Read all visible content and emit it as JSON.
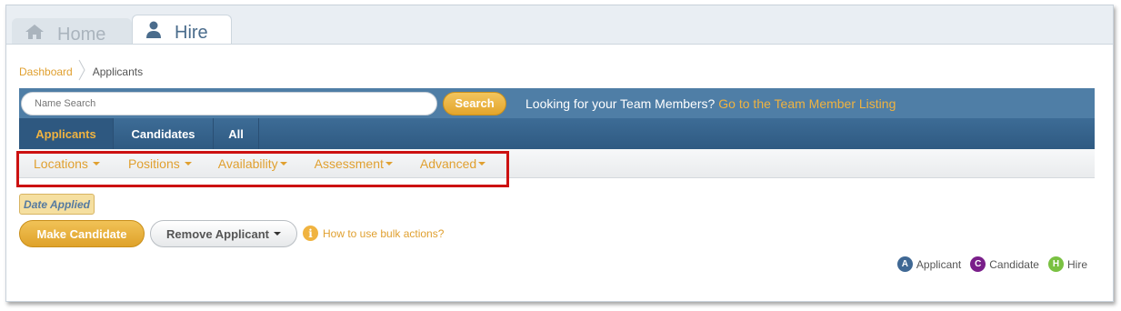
{
  "tabs": {
    "home_label": "Home",
    "hire_label": "Hire"
  },
  "breadcrumb": {
    "root": "Dashboard",
    "current": "Applicants"
  },
  "search": {
    "placeholder": "Name Search",
    "button_label": "Search",
    "team_text": "Looking for your Team Members?",
    "team_link": "Go to the Team Member Listing"
  },
  "subtabs": [
    {
      "label": "Applicants",
      "active": true
    },
    {
      "label": "Candidates",
      "active": false
    },
    {
      "label": "All",
      "active": false
    }
  ],
  "filters": [
    "Locations",
    "Positions",
    "Availability",
    "Assessment",
    "Advanced"
  ],
  "sort_badge": "Date Applied",
  "actions": {
    "make_candidate": "Make Candidate",
    "remove_applicant": "Remove Applicant",
    "bulk_help": "How to use bulk actions?"
  },
  "legend": [
    {
      "letter": "A",
      "label": "Applicant",
      "color": "#3f6894"
    },
    {
      "letter": "C",
      "label": "Candidate",
      "color": "#7a1f8a"
    },
    {
      "letter": "H",
      "label": "Hire",
      "color": "#7ac142"
    }
  ],
  "colors": {
    "accent": "#e0a030",
    "nav_blue": "#4f7ea6",
    "highlight": "#cc1111"
  }
}
